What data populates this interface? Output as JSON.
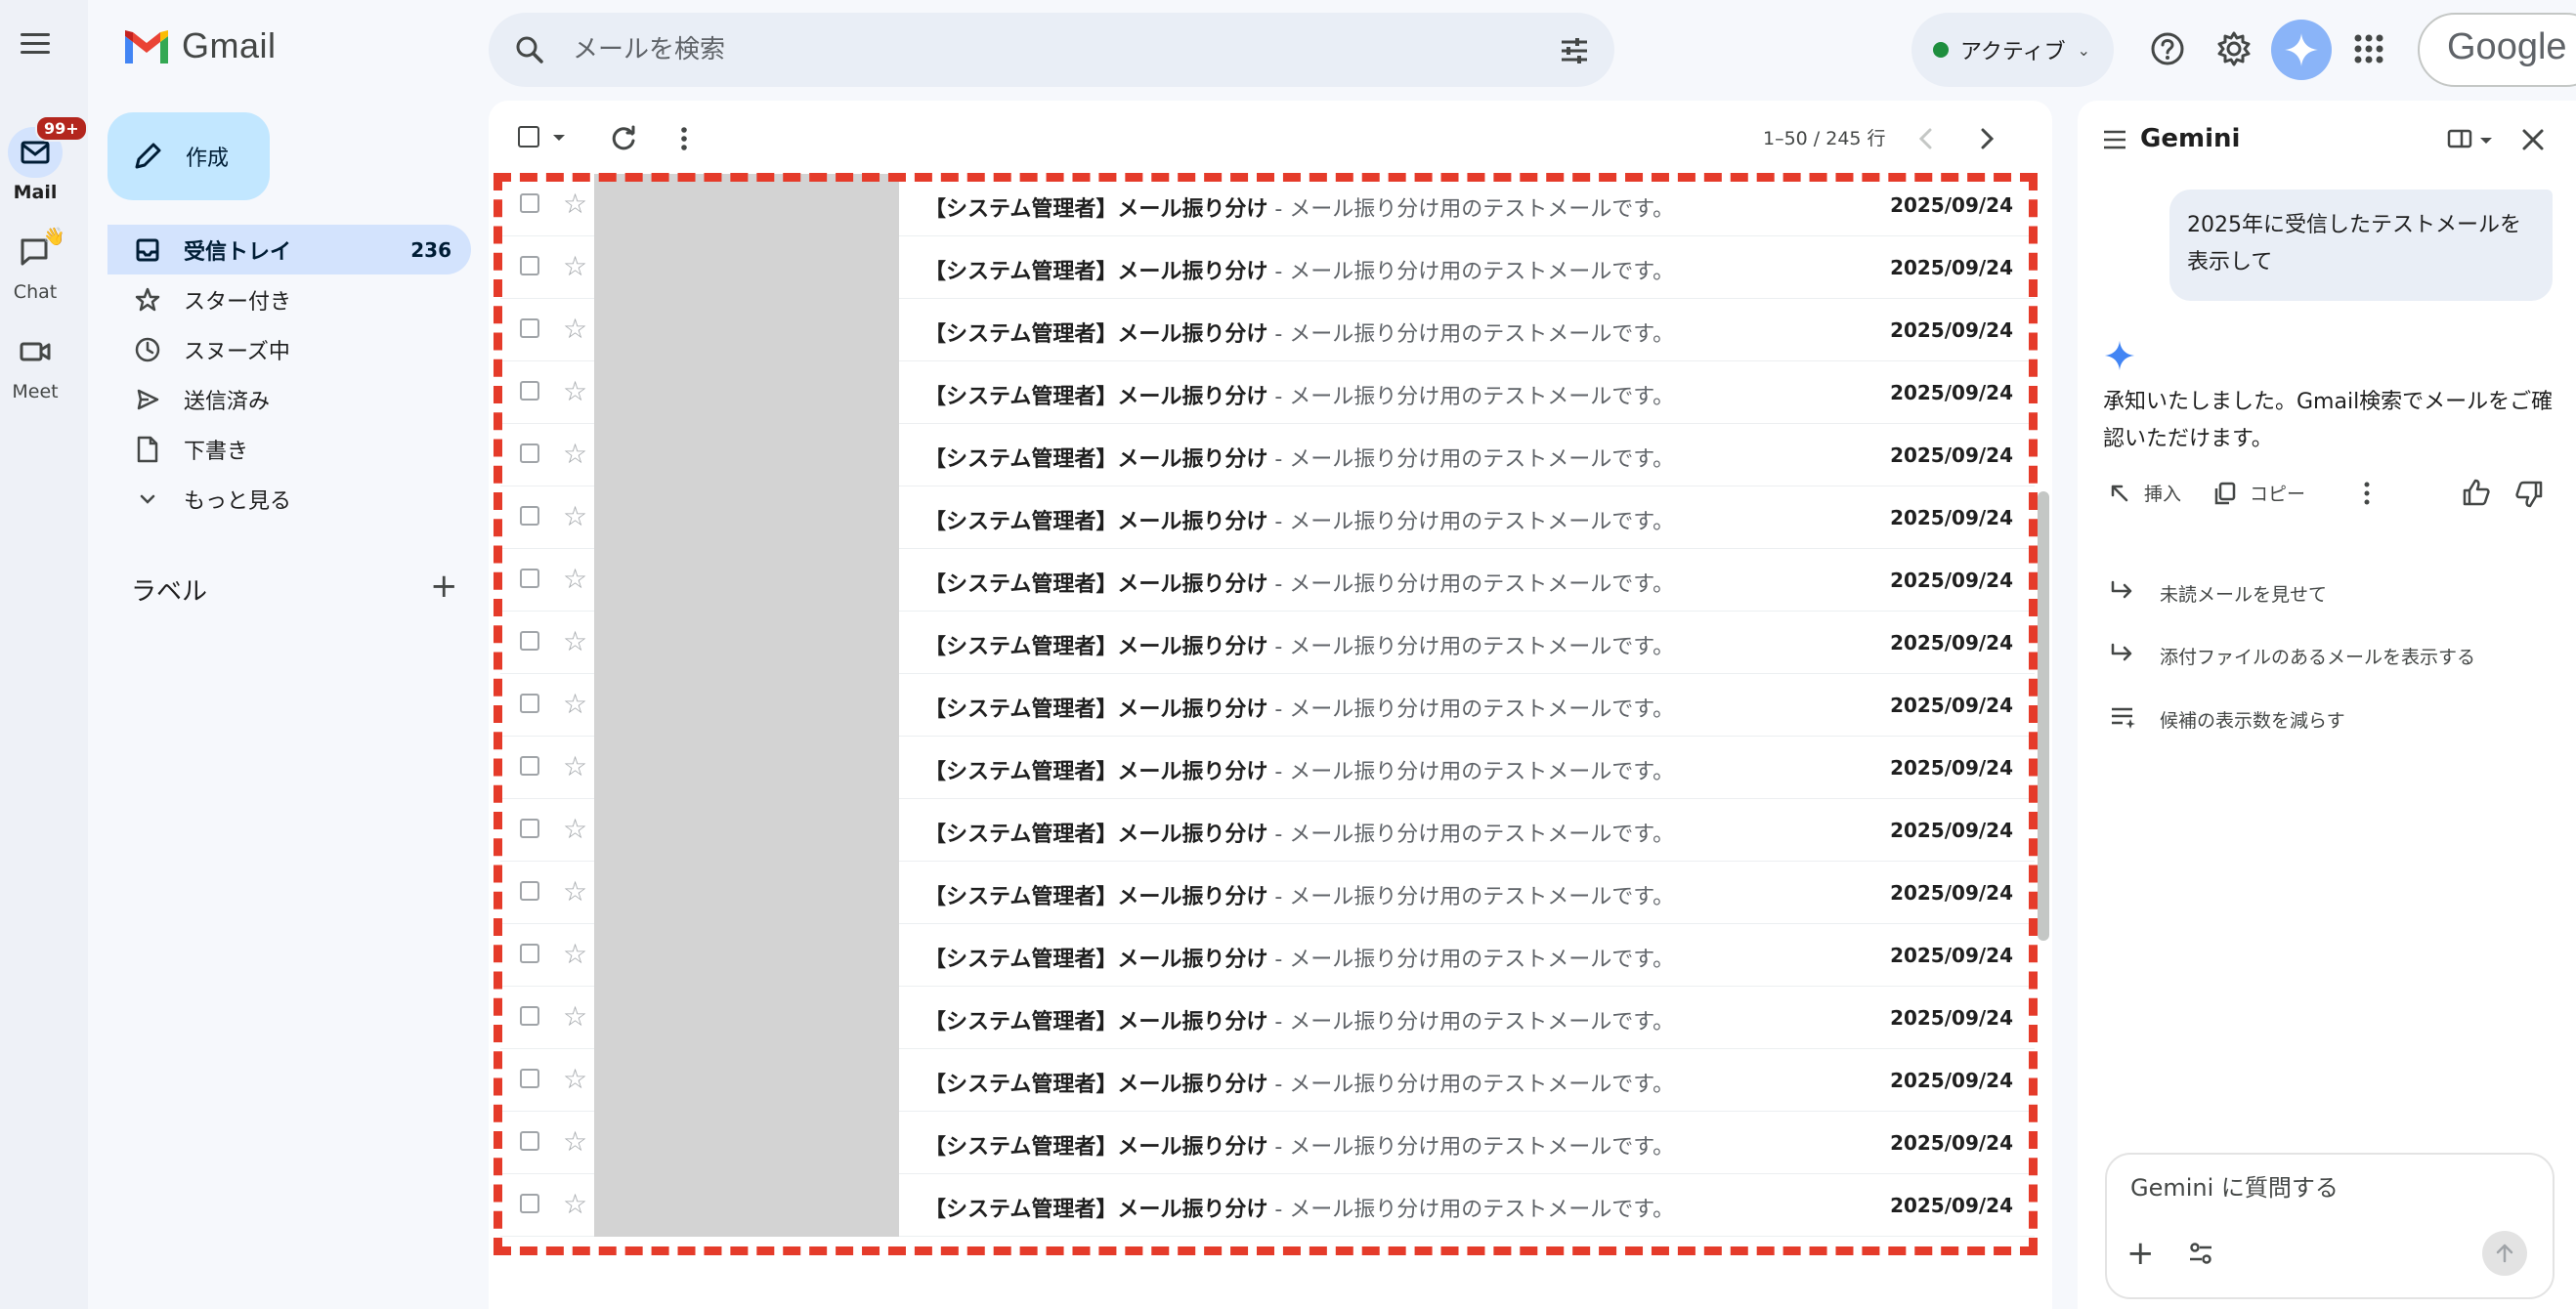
{
  "app": {
    "name": "Gmail"
  },
  "rail": {
    "items": [
      {
        "label": "Mail",
        "badge": "99+"
      },
      {
        "label": "Chat"
      },
      {
        "label": "Meet"
      }
    ]
  },
  "search": {
    "placeholder": "メールを検索"
  },
  "status": {
    "label": "アクティブ",
    "color": "#1e8e3e"
  },
  "account": {
    "label": "Google"
  },
  "compose": {
    "label": "作成"
  },
  "nav": {
    "items": [
      {
        "label": "受信トレイ",
        "count": "236",
        "icon": "inbox-icon"
      },
      {
        "label": "スター付き",
        "icon": "star-icon"
      },
      {
        "label": "スヌーズ中",
        "icon": "clock-icon"
      },
      {
        "label": "送信済み",
        "icon": "send-icon"
      },
      {
        "label": "下書き",
        "icon": "draft-icon"
      },
      {
        "label": "もっと見る",
        "icon": "chevron-down-icon"
      }
    ],
    "labels_heading": "ラベル"
  },
  "toolbar": {
    "pager": "1–50 / 245 行"
  },
  "mail": {
    "rows": [
      {
        "subject": "【システム管理者】メール振り分け",
        "snippet": " - メール振り分け用のテストメールです。",
        "date": "2025/09/24"
      },
      {
        "subject": "【システム管理者】メール振り分け",
        "snippet": " - メール振り分け用のテストメールです。",
        "date": "2025/09/24"
      },
      {
        "subject": "【システム管理者】メール振り分け",
        "snippet": " - メール振り分け用のテストメールです。",
        "date": "2025/09/24"
      },
      {
        "subject": "【システム管理者】メール振り分け",
        "snippet": " - メール振り分け用のテストメールです。",
        "date": "2025/09/24"
      },
      {
        "subject": "【システム管理者】メール振り分け",
        "snippet": " - メール振り分け用のテストメールです。",
        "date": "2025/09/24"
      },
      {
        "subject": "【システム管理者】メール振り分け",
        "snippet": " - メール振り分け用のテストメールです。",
        "date": "2025/09/24"
      },
      {
        "subject": "【システム管理者】メール振り分け",
        "snippet": " - メール振り分け用のテストメールです。",
        "date": "2025/09/24"
      },
      {
        "subject": "【システム管理者】メール振り分け",
        "snippet": " - メール振り分け用のテストメールです。",
        "date": "2025/09/24"
      },
      {
        "subject": "【システム管理者】メール振り分け",
        "snippet": " - メール振り分け用のテストメールです。",
        "date": "2025/09/24"
      },
      {
        "subject": "【システム管理者】メール振り分け",
        "snippet": " - メール振り分け用のテストメールです。",
        "date": "2025/09/24"
      },
      {
        "subject": "【システム管理者】メール振り分け",
        "snippet": " - メール振り分け用のテストメールです。",
        "date": "2025/09/24"
      },
      {
        "subject": "【システム管理者】メール振り分け",
        "snippet": " - メール振り分け用のテストメールです。",
        "date": "2025/09/24"
      },
      {
        "subject": "【システム管理者】メール振り分け",
        "snippet": " - メール振り分け用のテストメールです。",
        "date": "2025/09/24"
      },
      {
        "subject": "【システム管理者】メール振り分け",
        "snippet": " - メール振り分け用のテストメールです。",
        "date": "2025/09/24"
      },
      {
        "subject": "【システム管理者】メール振り分け",
        "snippet": " - メール振り分け用のテストメールです。",
        "date": "2025/09/24"
      },
      {
        "subject": "【システム管理者】メール振り分け",
        "snippet": " - メール振り分け用のテストメールです。",
        "date": "2025/09/24"
      },
      {
        "subject": "【システム管理者】メール振り分け",
        "snippet": " - メール振り分け用のテストメールです。",
        "date": "2025/09/24"
      }
    ]
  },
  "gemini": {
    "title": "Gemini",
    "user_prompt": "2025年に受信したテストメールを表示して",
    "response": "承知いたしました。Gmail検索でメールをご確認いただけます。",
    "actions": {
      "insert": "挿入",
      "copy": "コピー"
    },
    "suggestions": [
      "未読メールを見せて",
      "添付ファイルのあるメールを表示する",
      "候補の表示数を減らす"
    ],
    "input_placeholder": "Gemini に質問する"
  },
  "colors": {
    "highlight_border": "#e53b2a",
    "accent": "#0b57d0",
    "nav_active": "#d3e3fd",
    "compose_bg": "#c2e7ff"
  }
}
